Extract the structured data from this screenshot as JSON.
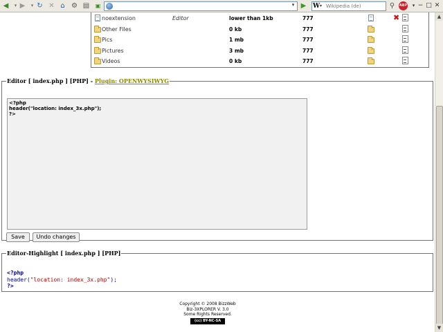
{
  "browser": {
    "search_placeholder": "Wikipedia (de)",
    "search_engine_glyph": "W",
    "abp_label": "ABP"
  },
  "files": [
    {
      "name": "noextension",
      "type": "Editor",
      "size": "lower than 1kb",
      "perm": "777",
      "kind": "file"
    },
    {
      "name": "Other Files",
      "type": "",
      "size": "0 kb",
      "perm": "777",
      "kind": "folder"
    },
    {
      "name": "Pics",
      "type": "",
      "size": "1 mb",
      "perm": "777",
      "kind": "folder"
    },
    {
      "name": "Pictures",
      "type": "",
      "size": "3 mb",
      "perm": "777",
      "kind": "folder"
    },
    {
      "name": "Videos",
      "type": "",
      "size": "0 kb",
      "perm": "777",
      "kind": "folder"
    }
  ],
  "editor": {
    "legend_prefix": "Editor [ index.php ] [PHP] - ",
    "plugin_link": "Plugin: OPENWYSIWYG",
    "code": "<?php\nheader(\"location: index_3x.php\");\n?>",
    "save_label": "Save",
    "undo_label": "Undo changes"
  },
  "highlight": {
    "legend": "Editor-Highlight [ index.php ] [PHP]",
    "line1": "<?php",
    "fn": "header",
    "paren_open": "(",
    "str": "\"location: index_3x.php\"",
    "paren_close": ");",
    "line3": "?>"
  },
  "footer": {
    "line1": "Copyright © 2008 BizzWeb",
    "line2": "Biz-3XPLORER V. 3.0",
    "line3": "Some Rights Reserved.",
    "badge": "(cc) BY-NC-SA"
  }
}
